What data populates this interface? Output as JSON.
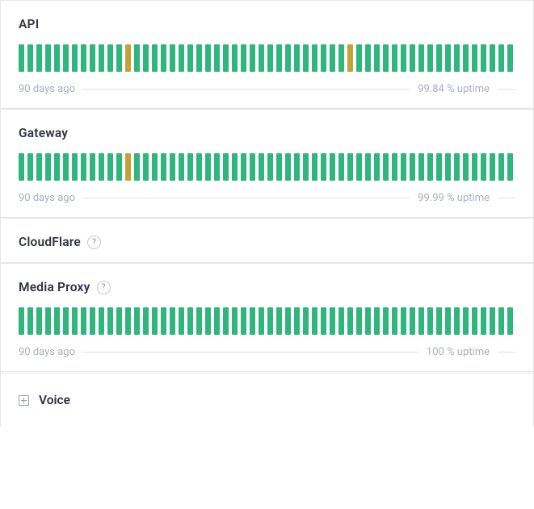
{
  "legend": {
    "ago": "90 days ago",
    "uptime_suffix": " uptime"
  },
  "components": [
    {
      "key": "api",
      "name": "API",
      "help": false,
      "has_bars": true,
      "uptime": "99.84 %",
      "warn_indices": [
        12,
        37
      ]
    },
    {
      "key": "gateway",
      "name": "Gateway",
      "help": false,
      "has_bars": true,
      "uptime": "99.99 %",
      "warn_indices": [
        12
      ]
    },
    {
      "key": "cloudflare",
      "name": "CloudFlare",
      "help": true,
      "has_bars": false,
      "uptime": null,
      "warn_indices": []
    },
    {
      "key": "media-proxy",
      "name": "Media Proxy",
      "help": true,
      "has_bars": true,
      "uptime": "100 %",
      "warn_indices": []
    }
  ],
  "voice": {
    "name": "Voice"
  },
  "bar_count": 58
}
